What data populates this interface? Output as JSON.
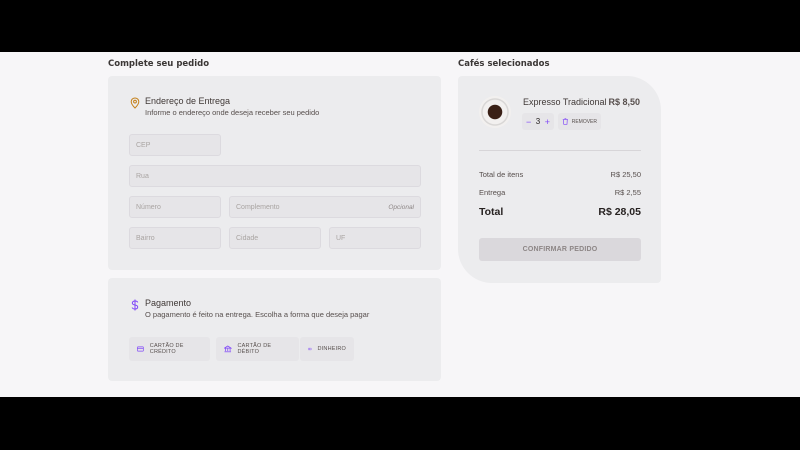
{
  "colors": {
    "accent_purple": "#8047f8",
    "accent_yellow": "#c47f17",
    "background": "#f7f6f8",
    "card": "#ececee"
  },
  "left_title": "Complete seu pedido",
  "right_title": "Cafés selecionados",
  "address": {
    "icon": "map-pin-icon",
    "title": "Endereço de Entrega",
    "subtitle": "Informe o endereço onde deseja receber seu pedido",
    "placeholders": {
      "cep": "CEP",
      "rua": "Rua",
      "numero": "Número",
      "complemento": "Complemento",
      "complemento_optional": "Opcional",
      "bairro": "Bairro",
      "cidade": "Cidade",
      "uf": "UF"
    }
  },
  "payment": {
    "icon": "dollar-icon",
    "title": "Pagamento",
    "subtitle": "O pagamento é feito na entrega. Escolha a forma que deseja pagar",
    "options": [
      {
        "icon": "credit-card-icon",
        "label": "CARTÃO DE CRÉDITO"
      },
      {
        "icon": "bank-icon",
        "label": "CARTÃO DE DÉBITO"
      },
      {
        "icon": "money-icon",
        "label": "DINHEIRO"
      }
    ]
  },
  "cart": {
    "item": {
      "name": "Expresso Tradicional",
      "price": "R$ 8,50",
      "quantity": "3",
      "minus": "−",
      "plus": "+",
      "remove_label": "REMOVER"
    },
    "summary": {
      "items_label": "Total de itens",
      "items_value": "R$ 25,50",
      "delivery_label": "Entrega",
      "delivery_value": "R$ 2,55",
      "total_label": "Total",
      "total_value": "R$ 28,05"
    },
    "confirm_label": "CONFIRMAR PEDIDO"
  }
}
